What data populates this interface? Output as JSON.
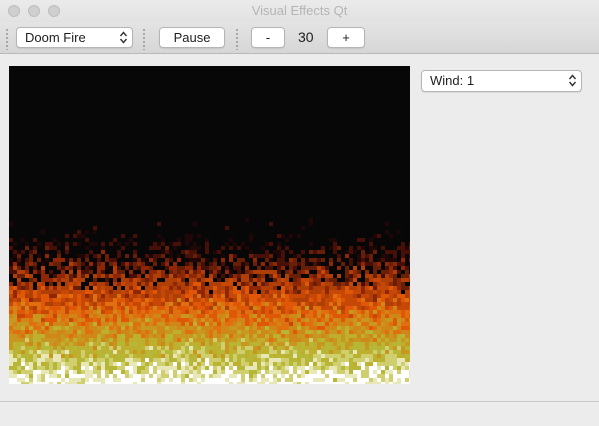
{
  "window": {
    "title": "Visual Effects Qt"
  },
  "toolbar": {
    "effect_select": {
      "selected": "Doom Fire"
    },
    "pause_label": "Pause",
    "minus_label": "-",
    "plus_label": "+",
    "fps_value": "30"
  },
  "side_panel": {
    "wind_select": {
      "selected": "Wind: 1"
    }
  },
  "fire": {
    "colors": [
      "#070707",
      "#1f0707",
      "#470f07",
      "#671f07",
      "#8f2707",
      "#af3f07",
      "#c74707",
      "#df5707",
      "#df6f0f",
      "#cf8717",
      "#c7971f",
      "#bfaf2f",
      "#b7b737",
      "#cfcf6f",
      "#e7e7b7",
      "#ffffff"
    ]
  }
}
